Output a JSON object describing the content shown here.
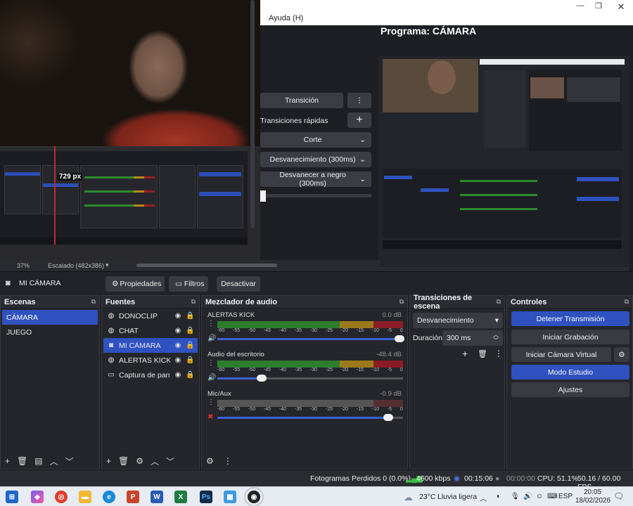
{
  "menu": {
    "help": "Ayuda (H)"
  },
  "program": {
    "title": "Programa: CÁMARA"
  },
  "preview": {
    "fps_overlay": "729 px",
    "zoom": "37%",
    "scale": "Escalado (482x386)"
  },
  "transition_panel": {
    "transition_button": "Transición",
    "quick_label": "Transiciones rápidas",
    "quick_items": [
      "Corte",
      "Desvanecimiento (300ms)",
      "Desvanecer a negro (300ms)"
    ]
  },
  "source_toolbar": {
    "source_name": "MI CÁMARA",
    "properties": "Propiedades",
    "filters": "Filtros",
    "deactivate": "Desactivar"
  },
  "scenes": {
    "title": "Escenas",
    "items": [
      "CÁMARA",
      "JUEGO"
    ]
  },
  "sources": {
    "title": "Fuentes",
    "items": [
      {
        "name": "DONOCLIP",
        "icon": "globe-icon"
      },
      {
        "name": "CHAT",
        "icon": "globe-icon"
      },
      {
        "name": "MI CÁMARA",
        "icon": "camera-icon"
      },
      {
        "name": "ALERTAS KICK",
        "icon": "globe-icon"
      },
      {
        "name": "Captura de pantalla",
        "icon": "monitor-icon"
      }
    ]
  },
  "mixer": {
    "title": "Mezclador de audio",
    "ticks": [
      "-60",
      "-55",
      "-50",
      "-45",
      "-40",
      "-35",
      "-30",
      "-25",
      "-20",
      "-15",
      "-10",
      "-5",
      "0"
    ],
    "channels": [
      {
        "name": "ALERTAS KICK",
        "db": "0.0 dB",
        "volume": 0.98,
        "muted": false
      },
      {
        "name": "Audio del escritorio",
        "db": "-48.4 dB",
        "volume": 0.24,
        "muted": false
      },
      {
        "name": "Mic/Aux",
        "db": "-0.9 dB",
        "volume": 0.92,
        "muted": true
      }
    ]
  },
  "scene_transitions": {
    "title": "Transiciones de escena",
    "selected": "Desvanecimiento",
    "duration_label": "Duración",
    "duration_value": "300 ms"
  },
  "controls": {
    "title": "Controles",
    "stop_stream": "Detener Transmisión",
    "start_recording": "Iniciar Grabación",
    "start_virtual_cam": "Iniciar Cámara Virtual",
    "studio_mode": "Modo Estudio",
    "settings": "Ajustes"
  },
  "status": {
    "dropped": "Fotogramas Perdidos 0 (0.0%)",
    "bitrate": "4600 kbps",
    "live_time": "00:15:06",
    "rec_time": "00:00:00",
    "cpu": "CPU: 51.1%",
    "fps": "50.16 / 60.00 FPS"
  },
  "taskbar": {
    "weather_temp": "23°C",
    "weather_text": "Lluvia ligera",
    "lang": "ESP",
    "time": "20:05",
    "date": "18/02/2026"
  },
  "colors": {
    "accent": "#2f52c0",
    "panel": "#25262b"
  }
}
